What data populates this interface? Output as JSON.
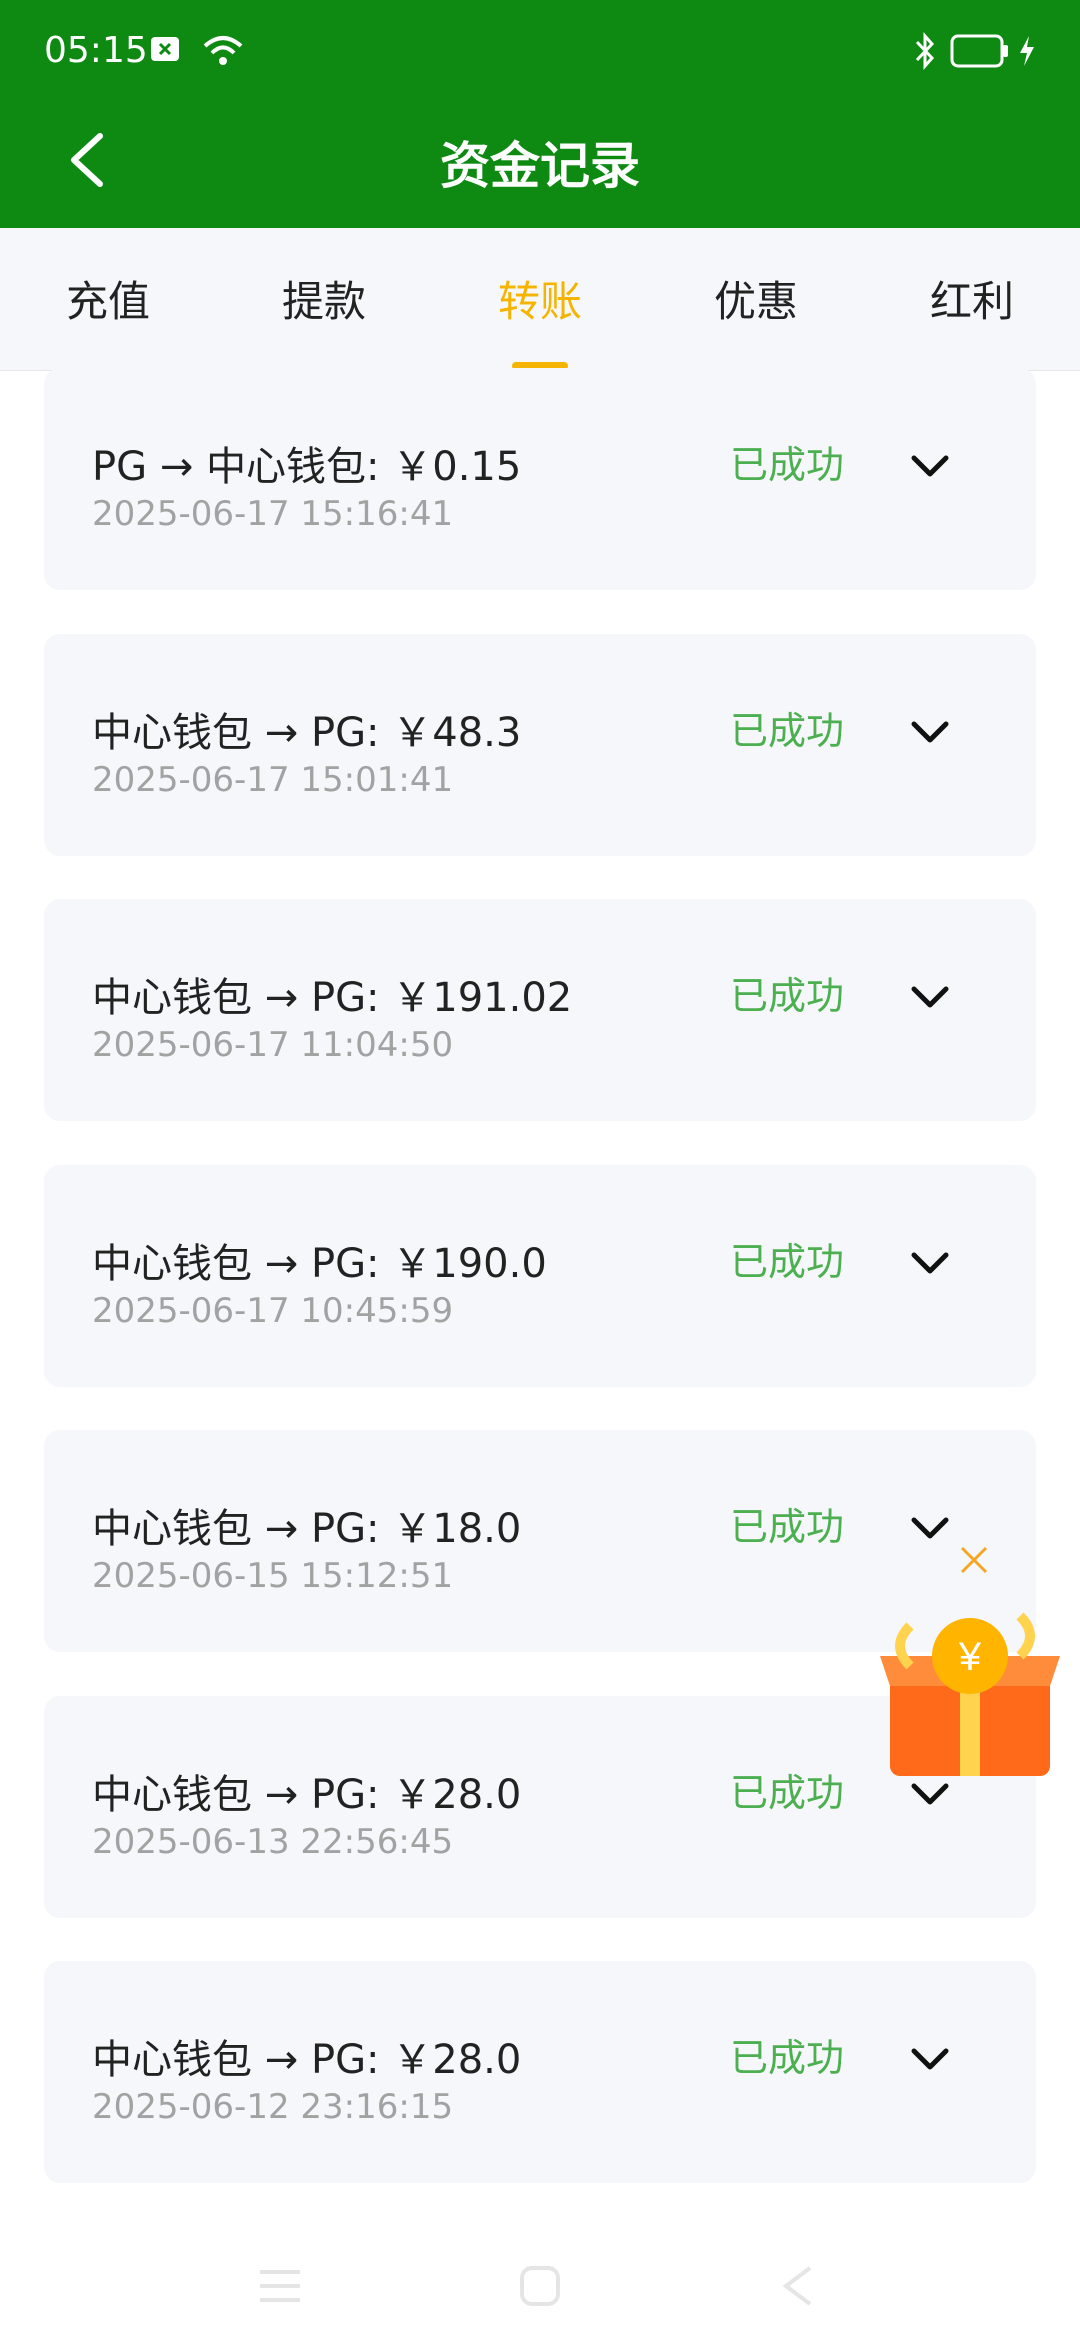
{
  "status_bar": {
    "time": "05:15",
    "icons": [
      "notification-x-icon",
      "wifi-icon",
      "bluetooth-icon",
      "battery-icon",
      "charging-icon"
    ]
  },
  "header": {
    "title": "资金记录",
    "back_icon": "back-arrow-icon"
  },
  "tabs": [
    {
      "label": "充值",
      "active": false
    },
    {
      "label": "提款",
      "active": false
    },
    {
      "label": "转账",
      "active": true
    },
    {
      "label": "优惠",
      "active": false
    },
    {
      "label": "红利",
      "active": false
    }
  ],
  "records": [
    {
      "text": "PG → 中心钱包: ￥0.15",
      "date": "2025-06-17 15:16:41",
      "status": "已成功"
    },
    {
      "text": "中心钱包 → PG: ￥48.3",
      "date": "2025-06-17 15:01:41",
      "status": "已成功"
    },
    {
      "text": "中心钱包 → PG: ￥191.02",
      "date": "2025-06-17 11:04:50",
      "status": "已成功"
    },
    {
      "text": "中心钱包 → PG: ￥190.0",
      "date": "2025-06-17 10:45:59",
      "status": "已成功"
    },
    {
      "text": "中心钱包 → PG: ￥18.0",
      "date": "2025-06-15 15:12:51",
      "status": "已成功"
    },
    {
      "text": "中心钱包 → PG: ￥28.0",
      "date": "2025-06-13 22:56:45",
      "status": "已成功"
    },
    {
      "text": "中心钱包 → PG: ￥28.0",
      "date": "2025-06-12 23:16:15",
      "status": "已成功"
    }
  ],
  "colors": {
    "header_bg": "#0e8a13",
    "active_tab": "#f5b400",
    "success": "#4caf50",
    "card_bg": "#f6f7fb"
  },
  "floating": {
    "icon": "gift-box-icon",
    "close_icon": "close-icon"
  },
  "nav": {
    "icons": [
      "menu-icon",
      "home-icon",
      "back-icon"
    ]
  }
}
